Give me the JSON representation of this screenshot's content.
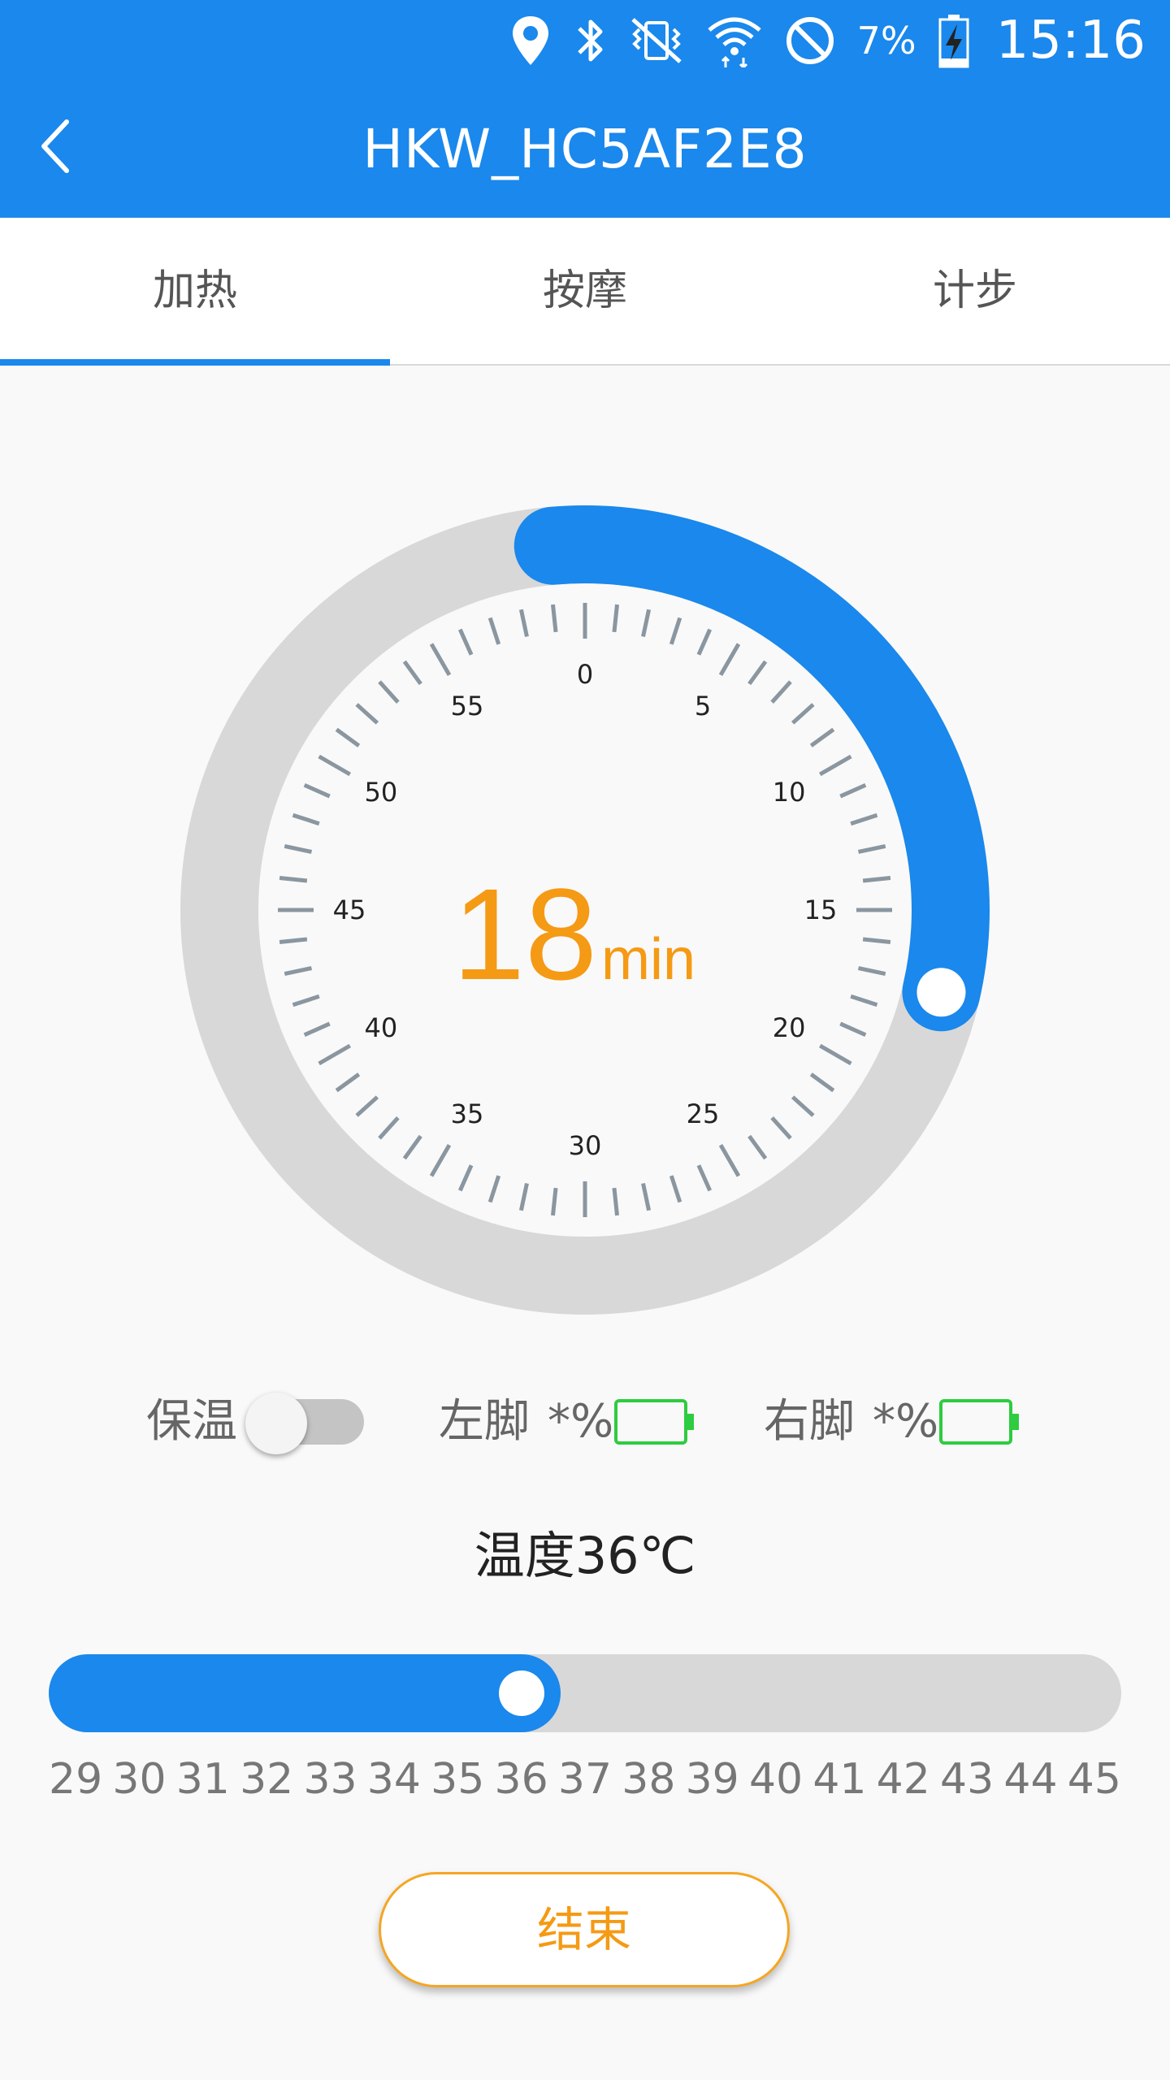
{
  "status_bar": {
    "battery_percent": "7%",
    "time": "15:16",
    "icons": [
      "location-icon",
      "bluetooth-icon",
      "vibrate-mute-icon",
      "wifi-icon",
      "do-not-disturb-icon",
      "battery-charging-icon"
    ]
  },
  "header": {
    "title": "HKW_HC5AF2E8"
  },
  "tabs": [
    {
      "label": "加热",
      "active": true
    },
    {
      "label": "按摩",
      "active": false
    },
    {
      "label": "计步",
      "active": false
    }
  ],
  "timer": {
    "value": "18",
    "unit": "min",
    "minutes": 18,
    "max_minutes": 60,
    "dial_labels": [
      "0",
      "5",
      "10",
      "15",
      "20",
      "25",
      "30",
      "35",
      "40",
      "45",
      "50",
      "55"
    ]
  },
  "controls": {
    "keep_warm_label": "保温",
    "keep_warm_on": false,
    "left_foot_label": "左脚",
    "left_foot_percent": "*%",
    "right_foot_label": "右脚",
    "right_foot_percent": "*%"
  },
  "temperature": {
    "label": "温度36℃",
    "value": 36,
    "min": 29,
    "max": 45,
    "scale": [
      "29",
      "30",
      "31",
      "32",
      "33",
      "34",
      "35",
      "36",
      "37",
      "38",
      "39",
      "40",
      "41",
      "42",
      "43",
      "44",
      "45"
    ]
  },
  "end_button": {
    "label": "结束"
  },
  "colors": {
    "primary": "#1a88ec",
    "accent": "#f59a14",
    "track": "#d8d8d8",
    "tick": "#8a96a0",
    "battery": "#2ecc40"
  }
}
